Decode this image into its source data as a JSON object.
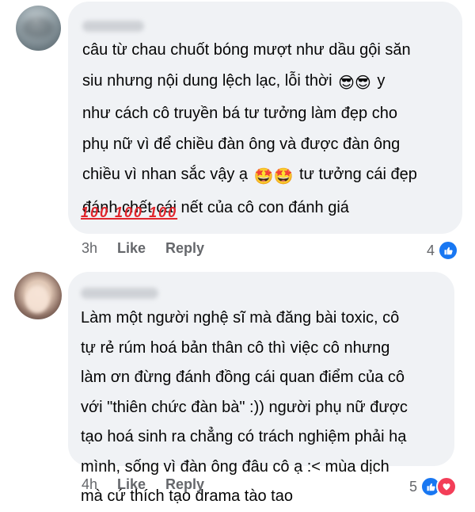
{
  "comments": [
    {
      "author": "Ngọc Anh",
      "lines": [
        "câu từ chau chuốt bóng mượt như dầu gội săn",
        "siu nhưng nội dung lệch lạc, lỗi thời",
        "như cách cô truyền bá tư tưởng làm đẹp cho",
        "phụ nữ vì để chiều đàn ông và được đàn ông",
        "chiều vì nhan sắc vậy ạ",
        "đánh chết cái nết của cô con đánh giá"
      ],
      "line2_suffix": "y",
      "line5_suffix": "tư tưởng cái đẹp",
      "line2_emoji": "😎😎",
      "line5_emoji": "🤩🤩",
      "hundred_icons": "100 100 100",
      "time": "3h",
      "like_label": "Like",
      "reply_label": "Reply",
      "reaction_count": "4",
      "reactions": [
        "like-icon"
      ]
    },
    {
      "author": "Nguyễn Như",
      "lines": [
        "Làm một người nghệ sĩ mà đăng bài toxic, cô",
        "tự rẻ rúm hoá bản thân cô thì việc cô nhưng",
        "làm ơn đừng đánh đồng cái quan điểm của cô",
        "với \"thiên chức đàn bà\" :)) người phụ nữ được",
        "tạo hoá sinh ra chẳng có trách nghiệm phải hạ",
        "mình, sống vì đàn ông đâu cô ạ :< mùa dịch",
        "mà cứ thích tạo drama tào tao"
      ],
      "time": "4h",
      "like_label": "Like",
      "reply_label": "Reply",
      "reaction_count": "5",
      "reactions": [
        "like-icon",
        "heart-icon"
      ]
    }
  ],
  "colors": {
    "bubble": "#f0f2f5",
    "meta_text": "#65676b",
    "like_blue": "#1877f2",
    "love_red": "#f33e58"
  }
}
